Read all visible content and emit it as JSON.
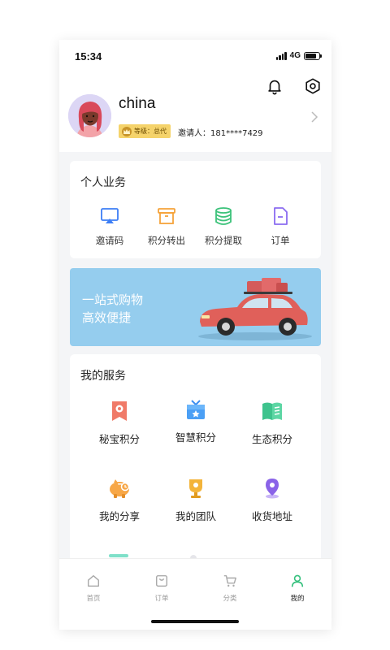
{
  "status_bar": {
    "time": "15:34",
    "network": "4G",
    "battery_level": 0.8
  },
  "header": {
    "username": "china",
    "level_badge": "等级：总代",
    "inviter": "邀请人：181****7429"
  },
  "personal_business": {
    "title": "个人业务",
    "items": [
      {
        "label": "邀请码",
        "icon": "screencast-icon",
        "color": "#3d7ef5"
      },
      {
        "label": "积分转出",
        "icon": "box-icon",
        "color": "#f5a33a"
      },
      {
        "label": "积分提取",
        "icon": "database-icon",
        "color": "#3cc27a"
      },
      {
        "label": "订单",
        "icon": "document-icon",
        "color": "#8b6cf0"
      }
    ]
  },
  "banner": {
    "line1": "一站式购物",
    "line2": "高效便捷"
  },
  "my_services": {
    "title": "我的服务",
    "items": [
      {
        "label": "秘宝积分",
        "icon": "bookmark-icon"
      },
      {
        "label": "智慧积分",
        "icon": "gift-tv-icon"
      },
      {
        "label": "生态积分",
        "icon": "book-icon"
      },
      {
        "label": "我的分享",
        "icon": "piggy-bank-icon"
      },
      {
        "label": "我的团队",
        "icon": "trophy-icon"
      },
      {
        "label": "收货地址",
        "icon": "location-pin-icon"
      }
    ]
  },
  "tabbar": {
    "tabs": [
      {
        "label": "首页",
        "icon": "home-icon",
        "active": false
      },
      {
        "label": "订单",
        "icon": "bag-icon",
        "active": false
      },
      {
        "label": "分类",
        "icon": "cart-icon",
        "active": false
      },
      {
        "label": "我的",
        "icon": "user-icon",
        "active": true
      }
    ]
  },
  "colors": {
    "accent_green": "#35c07d",
    "badge_gold": "#f5d36b",
    "banner_blue": "#95cdee"
  }
}
